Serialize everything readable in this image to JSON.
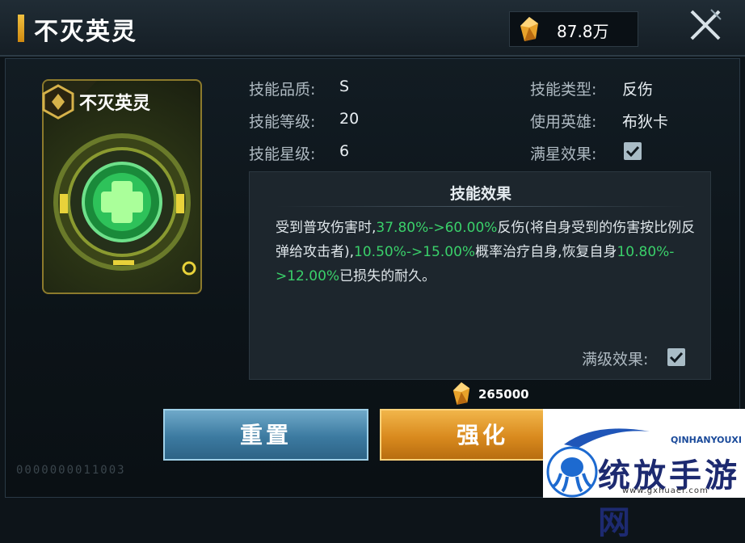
{
  "header": {
    "title": "不灭英灵",
    "currency_value": "87.8万"
  },
  "card": {
    "name": "不灭英灵"
  },
  "info": {
    "quality_label": "技能品质:",
    "quality_value": "S",
    "level_label": "技能等级:",
    "level_value": "20",
    "star_label": "技能星级:",
    "star_value": "6",
    "type_label": "技能类型:",
    "type_value": "反伤",
    "hero_label": "使用英雄:",
    "hero_value": "布狄卡",
    "maxstar_label": "满星效果:"
  },
  "effect": {
    "title": "技能效果",
    "t1": "受到普攻伤害时,",
    "h1": "37.80%->60.00%",
    "t2": "反伤(将自身受到的伤害按比例反弹给攻击者),",
    "h2": "10.50%->15.00%",
    "t3": "概率治疗自身,恢复自身",
    "h3": "10.80%->12.00%",
    "t4": "已损失的耐久。",
    "maxlevel_label": "满级效果:"
  },
  "cost": {
    "value": "265000"
  },
  "buttons": {
    "reset_label": "重置",
    "upgrade_label": "强化"
  },
  "footer": {
    "faint_text": "0000000011003"
  },
  "watermark": {
    "brand_en": "QINHANYOUXI",
    "brand_cn": "统放手游网",
    "url": "www.gxhuaer.com"
  },
  "colors": {
    "highlight": "#3ad06a",
    "reset_button": "#3c7aa0",
    "upgrade_button": "#d98a1e",
    "gold": "#f0c040"
  }
}
